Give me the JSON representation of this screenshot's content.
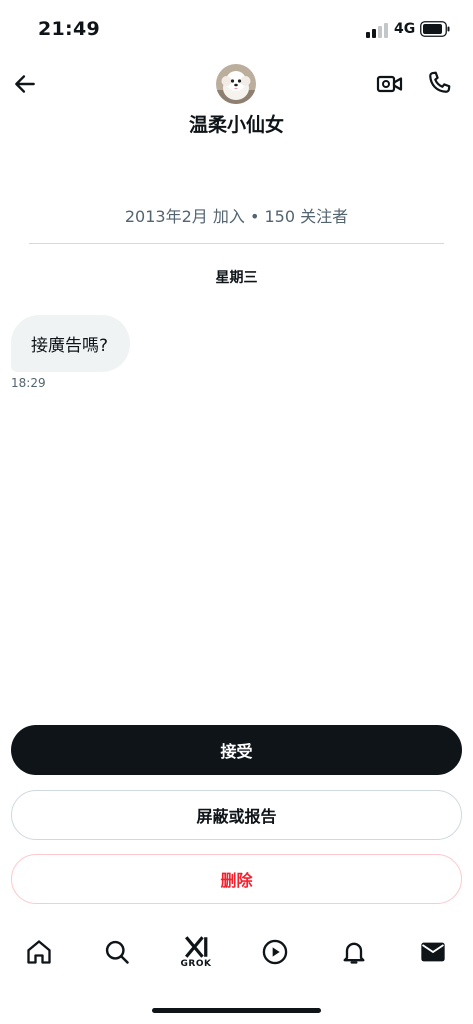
{
  "status_bar": {
    "time": "21:49",
    "network": "4G"
  },
  "header": {
    "contact_name": "温柔小仙女"
  },
  "profile": {
    "join_info": "2013年2月 加入 • 150 关注者"
  },
  "conversation": {
    "day_label": "星期三",
    "messages": [
      {
        "text": "接廣告嗎?",
        "time": "18:29"
      }
    ]
  },
  "actions": {
    "accept": "接受",
    "report": "屏蔽或报告",
    "delete": "删除"
  },
  "tabbar": {
    "grok_label": "GROK"
  },
  "colors": {
    "primary": "#0f1419",
    "secondary_text": "#536471",
    "danger": "#f4212e",
    "bubble": "#eff3f4"
  },
  "icons": [
    "arrow-left-icon",
    "video-icon",
    "phone-icon",
    "home-icon",
    "search-icon",
    "grok-icon",
    "play-icon",
    "bell-icon",
    "mail-icon"
  ]
}
